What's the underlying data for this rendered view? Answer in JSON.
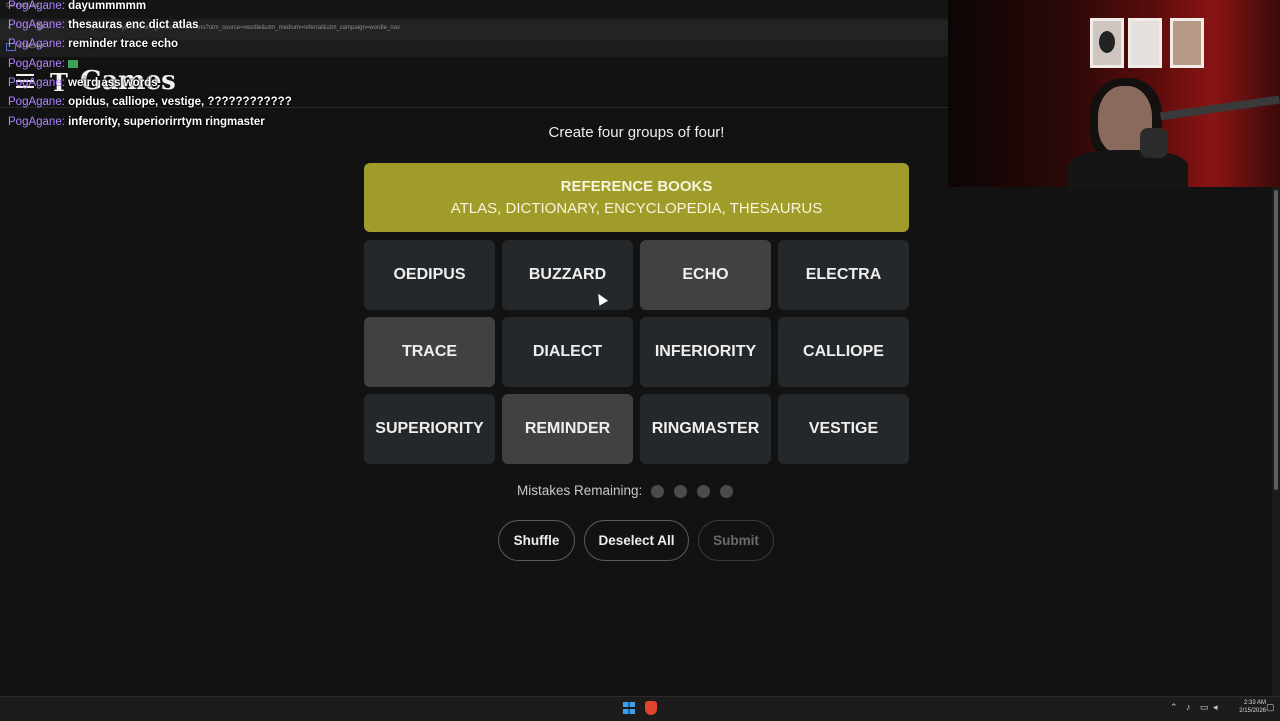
{
  "browser": {
    "tab_title": "Connections",
    "url": "https://www.nytimes.com/games/connections?utm_source=wordle&utm_medium=referral&utm_campaign=wordle_nav",
    "bookmark": "STREAM",
    "bookmark_extra": "AR"
  },
  "header": {
    "logo": "T",
    "title": "Games"
  },
  "chat": [
    {
      "user": "PogAgane",
      "message": "dayummmmm"
    },
    {
      "user": "PogAgane",
      "message": "thesauras enc dict atlas"
    },
    {
      "user": "PogAgane",
      "message": "reminder trace echo"
    },
    {
      "user": "PogAgane",
      "message": ""
    },
    {
      "user": "PogAgane",
      "message": "weird ass words"
    },
    {
      "user": "PogAgane",
      "message": "opidus, calliope, vestige, ????????????"
    },
    {
      "user": "PogAgane",
      "message": "inferority, superiorirrtym ringmaster"
    }
  ],
  "game": {
    "instructions": "Create four groups of four!",
    "solved_group": {
      "title": "REFERENCE BOOKS",
      "members": "ATLAS, DICTIONARY, ENCYCLOPEDIA, THESAURUS",
      "color": "#a09c2a"
    },
    "tiles": [
      {
        "word": "OEDIPUS",
        "selected": false
      },
      {
        "word": "BUZZARD",
        "selected": false
      },
      {
        "word": "ECHO",
        "selected": true
      },
      {
        "word": "ELECTRA",
        "selected": false
      },
      {
        "word": "TRACE",
        "selected": true
      },
      {
        "word": "DIALECT",
        "selected": false
      },
      {
        "word": "INFERIORITY",
        "selected": false
      },
      {
        "word": "CALLIOPE",
        "selected": false
      },
      {
        "word": "SUPERIORITY",
        "selected": false
      },
      {
        "word": "REMINDER",
        "selected": true
      },
      {
        "word": "RINGMASTER",
        "selected": false
      },
      {
        "word": "VESTIGE",
        "selected": false
      }
    ],
    "mistakes_label": "Mistakes Remaining:",
    "mistakes_remaining": 4,
    "buttons": {
      "shuffle": "Shuffle",
      "deselect": "Deselect All",
      "submit": "Submit"
    }
  },
  "taskbar": {
    "time": "2:33 AM",
    "date": "2/15/2026"
  }
}
